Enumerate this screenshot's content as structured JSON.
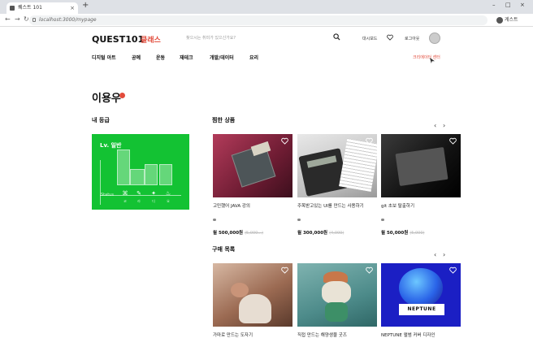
{
  "browser": {
    "tab_title": "퀘스트 101",
    "new_tab": "+",
    "url": "localhost:3000/mypage",
    "profile_label": "게스트"
  },
  "header": {
    "logo": "QUEST101",
    "logo_sub": "클래스",
    "search_placeholder": "찾으시는 취미가 있으신가요?",
    "dashboard": "대시보드",
    "login": "로그아웃"
  },
  "categories": [
    "디지털 아트",
    "공예",
    "운동",
    "재테크",
    "개발/데이터",
    "요리"
  ],
  "creator_center": "크리에이터 센터",
  "user": {
    "name": "이용우"
  },
  "grade": {
    "section_title": "내 등급",
    "level": "Lv. 일반",
    "stat_label": "Status",
    "bar_values": [
      0.45,
      0.6,
      0.2,
      0.3,
      0.3
    ],
    "skill_labels": [
      "코",
      "라",
      "디",
      "요"
    ]
  },
  "liked": {
    "section_title": "찜한 상품",
    "prev": "‹",
    "next": "›",
    "items": [
      {
        "title": "고민했어 JAVA 강의",
        "price": "월 500,000원",
        "old": "(5,000...)",
        "image": "book-photo"
      },
      {
        "title": "주목받고있는 UI를 만드는 사용하기",
        "price": "월 300,000원",
        "old": "(4,000)",
        "image": "calculator-photo"
      },
      {
        "title": "git 초보 탈출하기",
        "price": "월 50,000원",
        "old": "(5,000)",
        "image": "laptop-photo"
      }
    ]
  },
  "purchase": {
    "section_title": "구매 목록",
    "prev": "‹",
    "next": "›",
    "items": [
      {
        "title": "가마로 만드는 도자기",
        "image": "pottery-photo"
      },
      {
        "title": "직접 만드는 해양생물 굿즈",
        "image": "figure-photo"
      },
      {
        "title": "NEPTUNE 앨범 커버 디자인",
        "image": "neptune-photo"
      }
    ]
  },
  "colors": {
    "brand": "#e24b3b",
    "grade_card": "#13c233"
  }
}
